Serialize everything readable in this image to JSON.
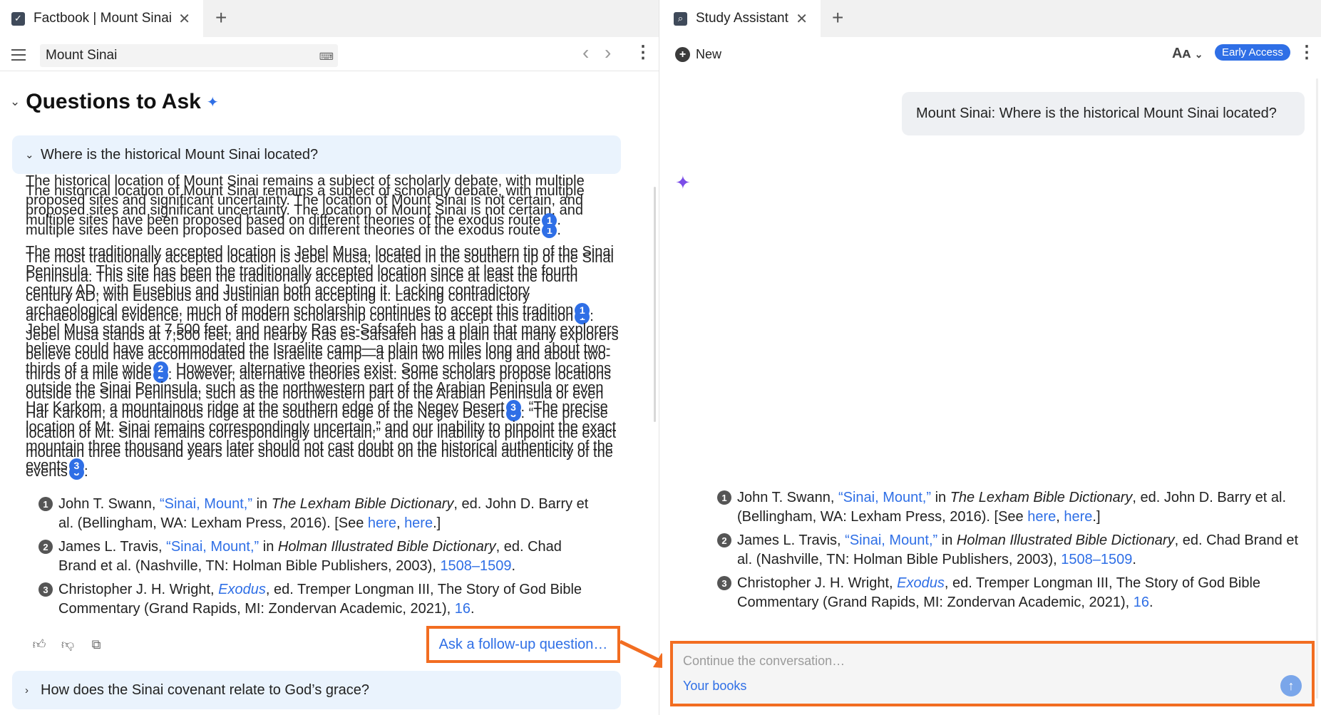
{
  "left": {
    "tab_title": "Factbook | Mount Sinai",
    "address": "Mount Sinai",
    "section_title": "Questions to Ask",
    "question1": "Where is the historical Mount Sinai located?",
    "question2": "How does the Sinai covenant relate to God’s grace?",
    "followup_label": "Ask a follow-up question…"
  },
  "right": {
    "tab_title": "Study Assistant",
    "new_label": "New",
    "font_btn": "Aᴀ",
    "badge": "Early Access",
    "user_message": "Mount Sinai: Where is the historical Mount Sinai located?",
    "input_placeholder": "Continue the conversation…",
    "books_label": "Your books"
  },
  "answer": {
    "p1": "The historical location of Mount Sinai remains a subject of scholarly debate, with multiple proposed sites and significant uncertainty. The location of Mount Sinai is not certain, and multiple sites have been proposed based on different theories of the exodus route",
    "p2a": "The most traditionally accepted location is Jebel Musa, located in the southern tip of the Sinai Peninsula. This site has been the traditionally accepted location since at least the fourth century AD, with Eusebius and Justinian both accepting it. Lacking contradictory archaeological evidence, much of modern scholarship continues to accept this tradition",
    "p2b": "Jebel Musa stands at 7,500 feet, and nearby Ras es-Safsafeh has a plain that many explorers believe could have accommodated the Israelite camp—a plain two miles long and about two-thirds of a mile wide",
    "p2c": "However, alternative theories exist. Some scholars propose locations outside the Sinai Peninsula, such as the northwestern part of the Arabian Peninsula or even Har Karkom, a mountainous ridge at the southern edge of the Negev Desert",
    "p2d": "“The precise location of Mt. Sinai remains correspondingly uncertain,” and our inability to pinpoint the exact mountain three thousand years later should not cast doubt on the historical authenticity of the events",
    "c1": "1",
    "c2": "2",
    "c3": "3"
  },
  "refs": [
    {
      "num": "1",
      "author": "John T. Swann, ",
      "title": "“Sinai, Mount,”",
      "in": " in ",
      "book": "The Lexham Bible Dictionary",
      "rest": ", ed. John D. Barry et al. (Bellingham, WA: Lexham Press, 2016). [See ",
      "link1": "here",
      "sep": ", ",
      "link2": "here",
      "end": ".]"
    },
    {
      "num": "2",
      "author": "James L. Travis, ",
      "title": "“Sinai, Mount,”",
      "in": " in ",
      "book": "Holman Illustrated Bible Dictionary",
      "rest": ", ed. Chad Brand et al. (Nashville, TN: Holman Bible Publishers, 2003), ",
      "link1": "1508–1509",
      "end": "."
    },
    {
      "num": "3",
      "author": "Christopher J. H. Wright, ",
      "title": "Exodus",
      "rest": ", ed. Tremper Longman III, The Story of God Bible Commentary (Grand Rapids, MI: Zondervan Academic, 2021), ",
      "link1": "16",
      "end": "."
    }
  ],
  "colors": {
    "accent": "#2f6fe6",
    "highlight": "#f26d21",
    "card": "#eaf3fd"
  },
  "icons": [
    "checkbox-icon",
    "close-icon",
    "plus-icon",
    "menu-icon",
    "keyboard-icon",
    "chevron-left-icon",
    "chevron-right-icon",
    "kebab-icon",
    "sparkle-icon",
    "chevron-down-icon",
    "chevron-right-icon",
    "thumbs-up-icon",
    "thumbs-down-icon",
    "copy-icon",
    "chat-icon",
    "send-icon"
  ]
}
